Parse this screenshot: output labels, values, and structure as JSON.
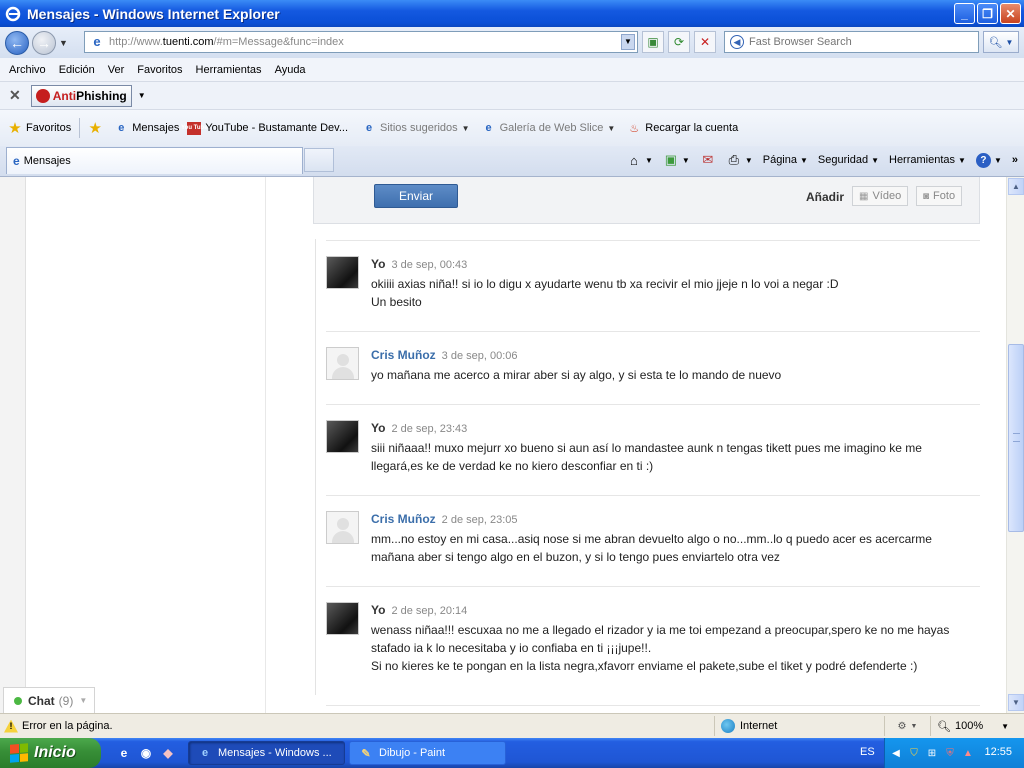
{
  "window": {
    "title": "Mensajes - Windows Internet Explorer"
  },
  "address": {
    "url_prefix": "http://www.",
    "url_domain": "tuenti.com",
    "url_rest": "/#m=Message&func=index"
  },
  "search": {
    "placeholder": "Fast Browser Search"
  },
  "menu": [
    "Archivo",
    "Edición",
    "Ver",
    "Favoritos",
    "Herramientas",
    "Ayuda"
  ],
  "antiphishing": {
    "anti": "Anti",
    "phishing": "Phishing"
  },
  "favorites": {
    "label": "Favoritos",
    "items": [
      "Mensajes",
      "YouTube - Bustamante Dev...",
      "Sitios sugeridos",
      "Galería de Web Slice",
      "Recargar la cuenta"
    ]
  },
  "tab": {
    "title": "Mensajes"
  },
  "commands": {
    "page": "Página",
    "security": "Seguridad",
    "tools": "Herramientas"
  },
  "composer": {
    "send": "Enviar",
    "add": "Añadir",
    "video": "Vídeo",
    "photo": "Foto"
  },
  "chat": {
    "label": "Chat",
    "count": "(9)"
  },
  "messages": [
    {
      "author": "Yo",
      "date": "3 de sep, 00:43",
      "lines": [
        "okiiii axias niña!! si io lo digu x ayudarte wenu tb xa recivir el mio jjeje n lo voi a negar :D",
        "Un besito"
      ]
    },
    {
      "author": "Cris Muñoz",
      "date": "3 de sep, 00:06",
      "lines": [
        "yo mañana me acerco a mirar aber si ay algo, y si esta te lo mando de nuevo"
      ]
    },
    {
      "author": "Yo",
      "date": "2 de sep, 23:43",
      "lines": [
        "siii niñaaa!! muxo mejurr xo bueno si aun así lo mandastee aunk n tengas tikett pues me imagino ke me",
        "llegará,es ke de verdad ke no kiero desconfiar en ti :)"
      ]
    },
    {
      "author": "Cris Muñoz",
      "date": "2 de sep, 23:05",
      "lines": [
        "mm...no estoy en mi casa...asiq nose si me abran devuelto algo o no...mm..lo q puedo acer es acercarme",
        "mañana aber si tengo algo en el buzon, y si lo tengo pues enviartelo otra vez"
      ]
    },
    {
      "author": "Yo",
      "date": "2 de sep, 20:14",
      "lines": [
        "wenass niñaa!!! escuxaa no me a llegado el rizador y ia me toi empezand a preocupar,spero ke no me hayas",
        "stafado ia k lo necesitaba y io confiaba en ti ¡¡¡jupe!!.",
        "Si no kieres ke te pongan en la lista negra,xfavorr enviame el pakete,sube el tiket y podré defenderte :)"
      ]
    }
  ],
  "status": {
    "error": "Error en la página.",
    "zone": "Internet",
    "zoom": "100%"
  },
  "taskbar": {
    "start": "Inicio",
    "items": [
      "Mensajes - Windows ...",
      "Dibujo - Paint"
    ],
    "lang": "ES",
    "clock": "12:55"
  }
}
